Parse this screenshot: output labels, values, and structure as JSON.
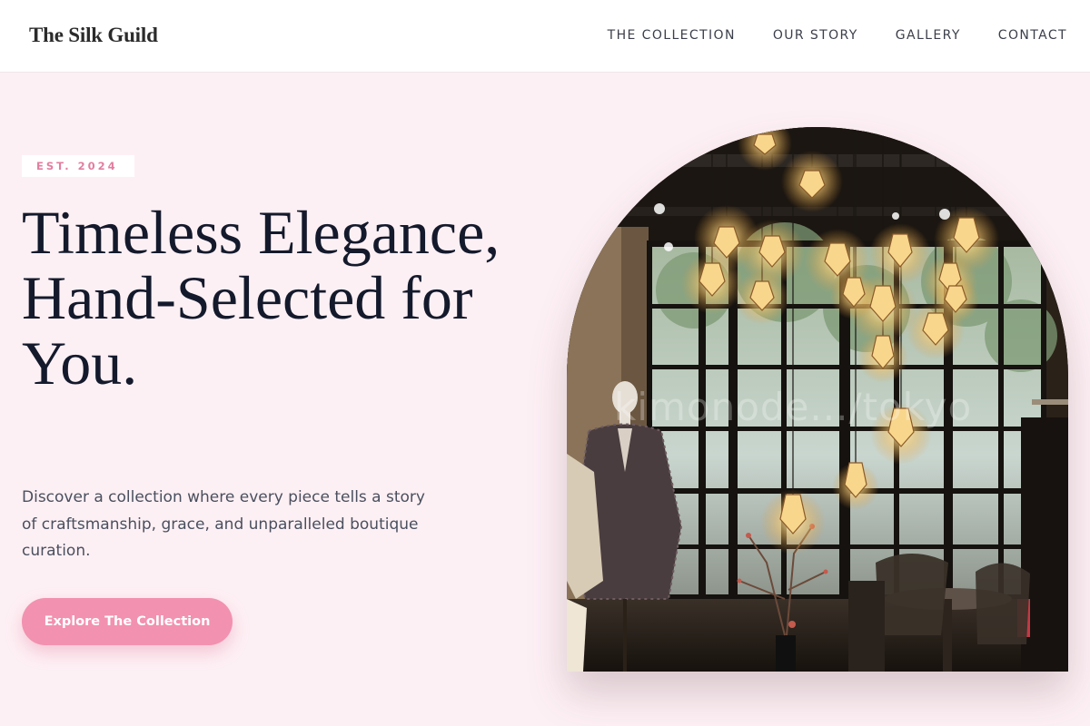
{
  "header": {
    "brand": "The Silk Guild",
    "nav": [
      "THE COLLECTION",
      "OUR STORY",
      "GALLERY",
      "CONTACT"
    ]
  },
  "hero": {
    "badge": "EST. 2024",
    "headline": "Timeless Elegance, Hand-Selected for You.",
    "lead": "Discover a collection where every piece tells a story of craftsmanship, grace, and unparalleled boutique curation.",
    "cta": "Explore The Collection",
    "image": {
      "watermark": "kimonode.../tokyo"
    }
  },
  "colors": {
    "page_background": "#fdf0f4",
    "accent": "#f291b0",
    "badge_text": "#e27ea0",
    "headline": "#141a2c"
  }
}
